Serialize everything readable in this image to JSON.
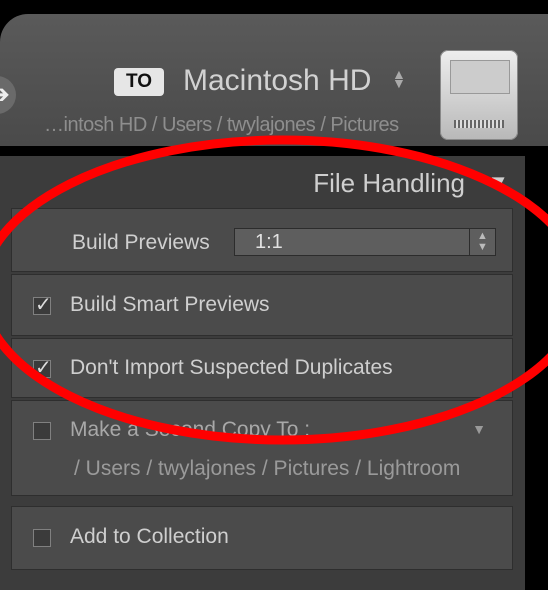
{
  "destination": {
    "to_badge": "TO",
    "volume_name": "Macintosh HD",
    "path": "…intosh HD / Users / twylajones / Pictures",
    "nav_arrow": "➔"
  },
  "file_handling": {
    "title": "File Handling",
    "build_previews": {
      "label": "Build Previews",
      "value": "1:1"
    },
    "build_smart_previews": {
      "label": "Build Smart Previews",
      "checked": true
    },
    "dont_import_duplicates": {
      "label": "Don't Import Suspected Duplicates",
      "checked": true
    },
    "second_copy": {
      "label": "Make a Second Copy To :",
      "checked": false,
      "path": "/ Users / twylajones / Pictures / Lightroom"
    },
    "add_to_collection": {
      "label": "Add to Collection",
      "checked": false
    }
  },
  "colors": {
    "annotation": "#ff0000",
    "panel": "#3c3c3c"
  }
}
